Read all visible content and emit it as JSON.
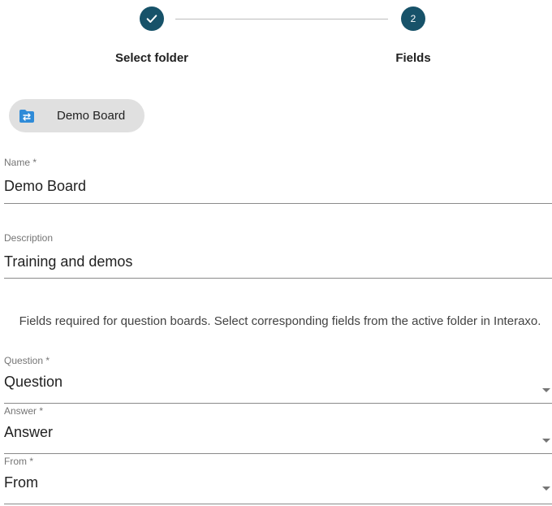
{
  "stepper": {
    "step1": {
      "label": "Select folder",
      "state": "completed"
    },
    "step2": {
      "number": "2",
      "label": "Fields",
      "state": "active"
    },
    "accent_color": "#175269"
  },
  "chip": {
    "icon": "folder-switch-icon",
    "label": "Demo Board",
    "icon_color": "#2f8bd8"
  },
  "form": {
    "name": {
      "label": "Name *",
      "value": "Demo Board"
    },
    "description": {
      "label": "Description",
      "value": "Training and demos"
    },
    "info": "Fields required for question boards. Select corresponding fields from the active folder in Interaxo.",
    "question": {
      "label": "Question *",
      "value": "Question"
    },
    "answer": {
      "label": "Answer *",
      "value": "Answer"
    },
    "from": {
      "label": "From *",
      "value": "From"
    }
  }
}
